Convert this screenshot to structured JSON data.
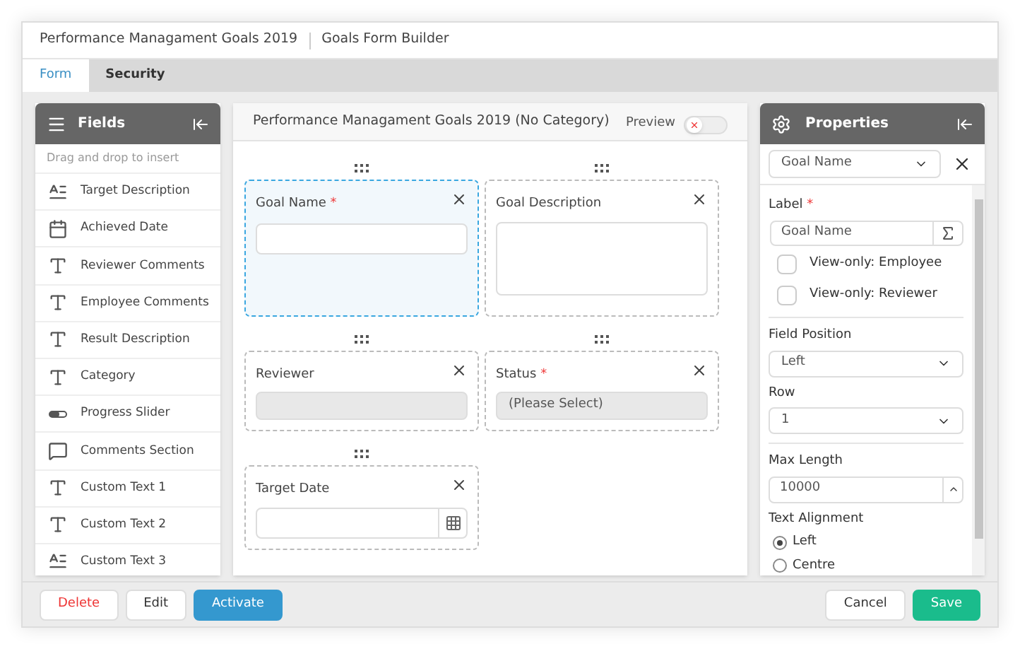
{
  "window": {
    "title": "Performance Managament Goals 2019",
    "subtitle": "Goals Form Builder"
  },
  "tabs": [
    {
      "label": "Form",
      "selected": true
    },
    {
      "label": "Security",
      "selected": false
    }
  ],
  "fields_panel": {
    "title": "Fields",
    "hint": "Drag and drop to insert",
    "items": [
      {
        "label": "Target Description",
        "kind": "textarea"
      },
      {
        "label": "Achieved Date",
        "kind": "date"
      },
      {
        "label": "Reviewer Comments",
        "kind": "text"
      },
      {
        "label": "Employee Comments",
        "kind": "text"
      },
      {
        "label": "Result Description",
        "kind": "text"
      },
      {
        "label": "Category",
        "kind": "text"
      },
      {
        "label": "Progress Slider",
        "kind": "slider"
      },
      {
        "label": "Comments Section",
        "kind": "comments"
      },
      {
        "label": "Custom Text 1",
        "kind": "text"
      },
      {
        "label": "Custom Text 2",
        "kind": "text"
      },
      {
        "label": "Custom Text 3",
        "kind": "textarea"
      }
    ]
  },
  "form": {
    "title": "Performance Managament Goals 2019 (No Category)",
    "preview": {
      "label": "Preview",
      "on": false
    },
    "rows": [
      [
        {
          "label": "Goal Name",
          "required_mark": "*",
          "selected": true,
          "kind": "input"
        },
        {
          "label": "Goal Description",
          "selected": false,
          "kind": "textarea"
        }
      ],
      [
        {
          "label": "Reviewer",
          "selected": false,
          "kind": "readonly"
        },
        {
          "label": "Status",
          "required_mark": "*",
          "selected": false,
          "kind": "select",
          "value": "(Please Select)"
        }
      ],
      [
        {
          "label": "Target Date",
          "selected": false,
          "kind": "date"
        }
      ]
    ]
  },
  "properties": {
    "title": "Properties",
    "field_select": "Goal Name",
    "label": {
      "label": "Label",
      "required_mark": "*",
      "value": "Goal Name"
    },
    "checkboxes": [
      {
        "label": "View-only: Employee",
        "checked": false
      },
      {
        "label": "View-only: Reviewer",
        "checked": false
      }
    ],
    "field_position": {
      "label": "Field Position",
      "value": "Left"
    },
    "row": {
      "label": "Row",
      "value": "1"
    },
    "max_length": {
      "label": "Max Length",
      "value": "10000"
    },
    "text_alignment": {
      "label": "Text Alignment",
      "options": [
        {
          "label": "Left",
          "selected": true
        },
        {
          "label": "Centre",
          "selected": false
        }
      ]
    }
  },
  "footer": {
    "left_buttons": [
      {
        "label": "Delete",
        "kind": "danger"
      },
      {
        "label": "Edit",
        "kind": "plain"
      },
      {
        "label": "Activate",
        "kind": "primary"
      }
    ],
    "right_buttons": [
      {
        "label": "Cancel",
        "kind": "plain"
      },
      {
        "label": "Save",
        "kind": "success"
      }
    ]
  }
}
